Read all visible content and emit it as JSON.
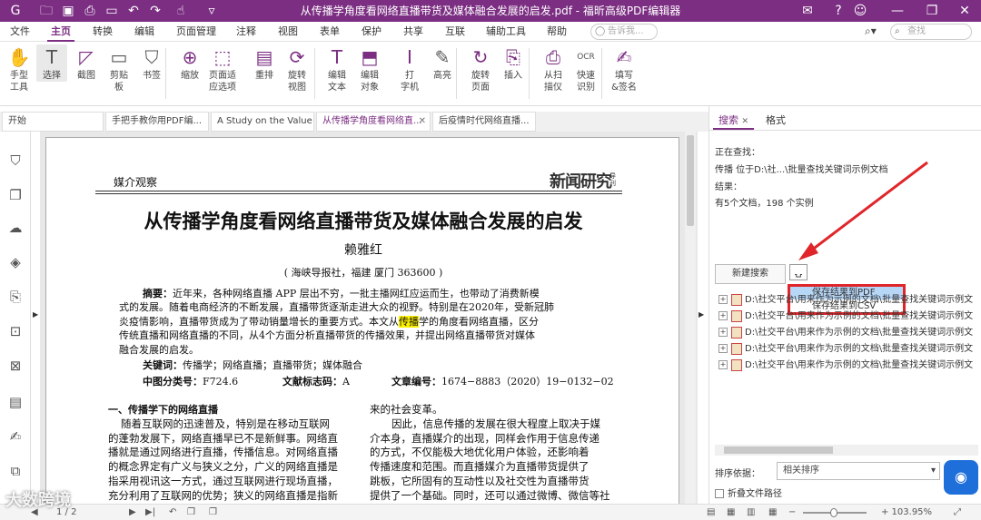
{
  "titlebar": {
    "title": "从传播学角度看网络直播带货及媒体融合发展的启发.pdf - 福昕高级PDF编辑器"
  },
  "menu": {
    "items": [
      "文件",
      "主页",
      "转换",
      "编辑",
      "页面管理",
      "注释",
      "视图",
      "表单",
      "保护",
      "共享",
      "互联",
      "辅助工具",
      "帮助"
    ],
    "tellme": "告诉我...",
    "find": "查找"
  },
  "ribbon": [
    {
      "id": "hand",
      "icon": "✋",
      "label": "手型\n工具"
    },
    {
      "id": "select",
      "icon": "T",
      "label": "选择"
    },
    {
      "id": "snapshot",
      "icon": "◸",
      "label": "截图"
    },
    {
      "id": "clipboard",
      "icon": "▭",
      "label": "剪贴\n板"
    },
    {
      "id": "bookmark",
      "icon": "⛉",
      "label": "书签"
    },
    {
      "id": "zoom",
      "icon": "⊕",
      "label": "缩放"
    },
    {
      "id": "fit",
      "icon": "⬚",
      "label": "页面适\n应选项"
    },
    {
      "id": "reflow",
      "icon": "▤",
      "label": "重排"
    },
    {
      "id": "rotate",
      "icon": "⟳",
      "label": "旋转\n视图"
    },
    {
      "id": "edittext",
      "icon": "T",
      "label": "编辑\n文本"
    },
    {
      "id": "editobj",
      "icon": "⬒",
      "label": "编辑\n对象"
    },
    {
      "id": "typewriter",
      "icon": "I",
      "label": "打\n字机"
    },
    {
      "id": "highlight",
      "icon": "✎",
      "label": "高亮"
    },
    {
      "id": "rotatepage",
      "icon": "↻",
      "label": "旋转\n页面"
    },
    {
      "id": "insert",
      "icon": "⎘",
      "label": "插入"
    },
    {
      "id": "scan",
      "icon": "⎙",
      "label": "从扫\n描仪"
    },
    {
      "id": "ocr",
      "icon": "OCR",
      "label": "快速\n识别"
    },
    {
      "id": "sign",
      "icon": "✍",
      "label": "填写\n&签名"
    }
  ],
  "tabs": [
    {
      "label": "开始"
    },
    {
      "label": "手把手教你用PDF编..."
    },
    {
      "label": "A Study on the Value ..."
    },
    {
      "label": "从传播学角度看网络直..."
    },
    {
      "label": "后疫情时代网络直播..."
    }
  ],
  "doc": {
    "column": "媒介观察",
    "logo": "新闻研究",
    "logo_sub": "导刊",
    "title": "从传播学角度看网络直播带货及媒体融合发展的启发",
    "author": "赖雅红",
    "affil": "( 海峡导报社，福建  厦门    363600 )",
    "abs_label": "摘要：",
    "abs_lines": [
      "近年来，各种网络直播 APP 层出不穷，一批主播网红应运而生，也带动了消费新模",
      "式的发展。随着电商经济的不断发展，直播带货逐渐走进大众的视野。特别是在2020年，受新冠肺",
      "炎疫情影响，直播带货成为了带动销量增长的重要方式。本文从",
      "学的角度看网络直播，区分",
      "传统直播和网络直播的不同，从4个方面分析直播带货的传播效果，并提出网络直播带货对媒体",
      "融合发展的启发。"
    ],
    "highlight": "传播",
    "kw_label": "关键词：",
    "kw": "传播学；网络直播；直播带货；媒体融合",
    "cls_label": "中图分类号：",
    "cls": "F724.6",
    "id_label": "文献标志码：",
    "id": "A",
    "no_label": "文章编号：",
    "no": "1674−8883（2020）19−0132−02",
    "sec": "一、传播学下的网络直播",
    "left": [
      "随着互联网的迅速普及，特别是在移动互联网",
      "的蓬勃发展下，网络直播早已不是新鲜事。网络直",
      "播就是通过网络进行直播，传播信息。对网络直播",
      "的概念界定有广义与狭义之分，广义的网络直播是",
      "指采用视讯这一方式，通过互联网进行现场直播，",
      "充分利用了互联网的优势；狭义的网络直播是指新"
    ],
    "right": [
      "来的社会变革。",
      "因此，信息传播的发展在很大程度上取决于媒",
      "介本身，直播媒介的出现，同样会作用于信息传递",
      "的方式，不仅能极大地优化用户体验，还影响着",
      "传播速度和范围。而直播媒介为直播带货提供了",
      "跳板，它所固有的互动性以及社交性为直播带货",
      "提供了一个基础。同时，还可以通过微博、微信等社"
    ]
  },
  "panel": {
    "tab_search": "搜索",
    "tab_format": "格式",
    "searching": "正在查找：",
    "query": "传播 位于D:\\社...\\批量查找关键词示例文档",
    "results_label": "结果：",
    "summary": "有5个文档，198 个实例",
    "new_search": "新建搜索",
    "save_pdf": "保存结果到PDF",
    "save_csv": "保存结果到CSV",
    "results": [
      "D:\\社交平台\\用来作为示例的文档\\批量查找关键词示例文",
      "D:\\社交平台\\用来作为示例的文档\\批量查找关键词示例文",
      "D:\\社交平台\\用来作为示例的文档\\批量查找关键词示例文",
      "D:\\社交平台\\用来作为示例的文档\\批量查找关键词示例文",
      "D:\\社交平台\\用来作为示例的文档\\批量查找关键词示例文"
    ],
    "sort_label": "排序依据：",
    "sort_value": "相关排序",
    "fold_label": "折叠文件路径"
  },
  "status": {
    "page": "1 / 2",
    "zoom": "+ 103.95%"
  },
  "watermark": "大数跨境"
}
